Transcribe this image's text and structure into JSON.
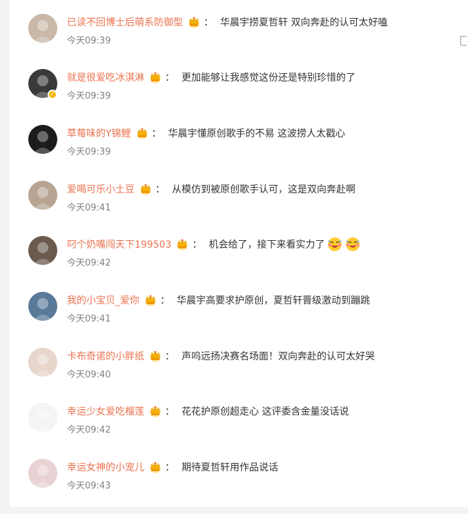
{
  "comments": [
    {
      "username": "已读不回博士后萌系防御型",
      "text": "华晨宇捞夏哲轩 双向奔赴的认可太好嗑",
      "time": "今天09:39",
      "avatar_color": "#c9b8a8",
      "verified": false
    },
    {
      "username": "就是很爱吃冰淇淋",
      "text": "更加能够让我感觉这份还是特别珍惜的了",
      "time": "今天09:39",
      "avatar_color": "#3a3a3a",
      "verified": true
    },
    {
      "username": "草莓味的Y锦鲤",
      "text": "华晨宇懂原创歌手的不易 这波捞人太戳心",
      "time": "今天09:39",
      "avatar_color": "#1c1c1c",
      "verified": false
    },
    {
      "username": "爱喝可乐小土豆",
      "text": "从模仿到被原创歌手认可，这是双向奔赴啊",
      "time": "今天09:41",
      "avatar_color": "#b7a493",
      "verified": false
    },
    {
      "username": "叼个奶嘴闯天下199503",
      "text": "机会给了，接下来看实力了",
      "time": "今天09:42",
      "avatar_color": "#6b5a4e",
      "verified": false,
      "emojis": [
        "laugh-cry-emoji",
        "laugh-cry-emoji"
      ]
    },
    {
      "username": "我的小宝贝_爱你",
      "text": "华晨宇高要求护原创，夏哲轩晋级激动到蹦跳",
      "time": "今天09:41",
      "avatar_color": "#5a7a9a",
      "verified": false
    },
    {
      "username": "卡布奇诺的小胖纸",
      "text": "声呜远扬决赛名场面！双向奔赴的认可太好哭",
      "time": "今天09:40",
      "avatar_color": "#e8d6cc",
      "verified": false
    },
    {
      "username": "幸运少女爱吃榴莲",
      "text": "花花护原创超走心 这评委含金量没话说",
      "time": "今天09:42",
      "avatar_color": "#f4f4f4",
      "verified": false
    },
    {
      "username": "幸运女神的小宠儿",
      "text": "期待夏哲轩用作品说话",
      "time": "今天09:43",
      "avatar_color": "#e9d2d4",
      "verified": false
    }
  ],
  "colors": {
    "username": "#eb7350",
    "text": "#333333",
    "time": "#808080",
    "crown": "#f7b500"
  }
}
